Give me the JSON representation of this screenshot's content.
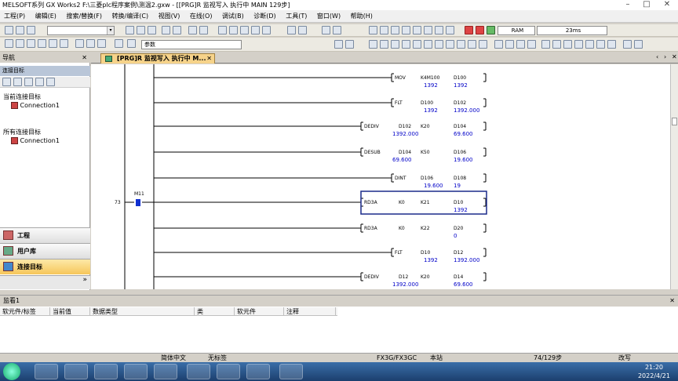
{
  "window": {
    "title": "MELSOFT系列 GX Works2 F:\\三菱plc程序案例\\测温2.gxw - [[PRG]R 监视写入 执行中 MAIN 129步]"
  },
  "menu": [
    "工程(P)",
    "编辑(E)",
    "搜索/替换(F)",
    "转换/编译(C)",
    "视图(V)",
    "在线(O)",
    "调试(B)",
    "诊断(D)",
    "工具(T)",
    "窗口(W)",
    "帮助(H)"
  ],
  "toolbar": {
    "combo_param": "参数",
    "mem_type": "RAM",
    "scan_time": "23ms"
  },
  "nav": {
    "title": "导航",
    "section": "连接目标",
    "current_label": "当前连接目标",
    "current_conn": "Connection1",
    "all_label": "所有连接目标",
    "all_conn": "Connection1",
    "buttons": [
      "工程",
      "用户库",
      "连接目标"
    ]
  },
  "tab": {
    "label": "[PRG]R 监视写入 执行中 M..."
  },
  "ladder": {
    "step": "73",
    "contact": "M11",
    "rungs": [
      {
        "op": "MOV",
        "a1": "K4M100",
        "a2": "D100",
        "v1": "1392",
        "v2": "1392"
      },
      {
        "op": "FLT",
        "a1": "D100",
        "a2": "D102",
        "v1": "1392",
        "v2": "1392.000"
      },
      {
        "op": "DEDIV",
        "a1": "D102",
        "a2": "K20",
        "a3": "D104",
        "v1": "1392.000",
        "v3": "69.600"
      },
      {
        "op": "DESUB",
        "a1": "D104",
        "a2": "K50",
        "a3": "D106",
        "v1": "69.600",
        "v3": "19.600"
      },
      {
        "op": "DINT",
        "a1": "D106",
        "a2": "D108",
        "v1": "19.600",
        "v2": "19"
      },
      {
        "op": "RD3A",
        "a1": "K0",
        "a2": "K21",
        "a3": "D10",
        "v3": "1392"
      },
      {
        "op": "RD3A",
        "a1": "K0",
        "a2": "K22",
        "a3": "D20",
        "v3": "0"
      },
      {
        "op": "FLT",
        "a1": "D10",
        "a2": "D12",
        "v1": "1392",
        "v2": "1392.000"
      },
      {
        "op": "DEDIV",
        "a1": "D12",
        "a2": "K20",
        "a3": "D14",
        "v1": "1392.000",
        "v3": "69.600"
      }
    ]
  },
  "monitor": {
    "title": "监看1",
    "columns": [
      "软元件/标签",
      "当前值",
      "数据类型",
      "类",
      "软元件",
      "注释"
    ]
  },
  "status": {
    "lang": "简体中文",
    "label": "无标签",
    "plc": "FX3G/FX3GC",
    "station": "本站",
    "steps": "74/129步",
    "mode": "改写"
  },
  "clock": {
    "time": "21:20",
    "date": "2022/4/21"
  },
  "colors": {
    "monitor_value": "#0000c8",
    "active_nav": "#f6c65a",
    "taskbar": "#2a5590"
  }
}
